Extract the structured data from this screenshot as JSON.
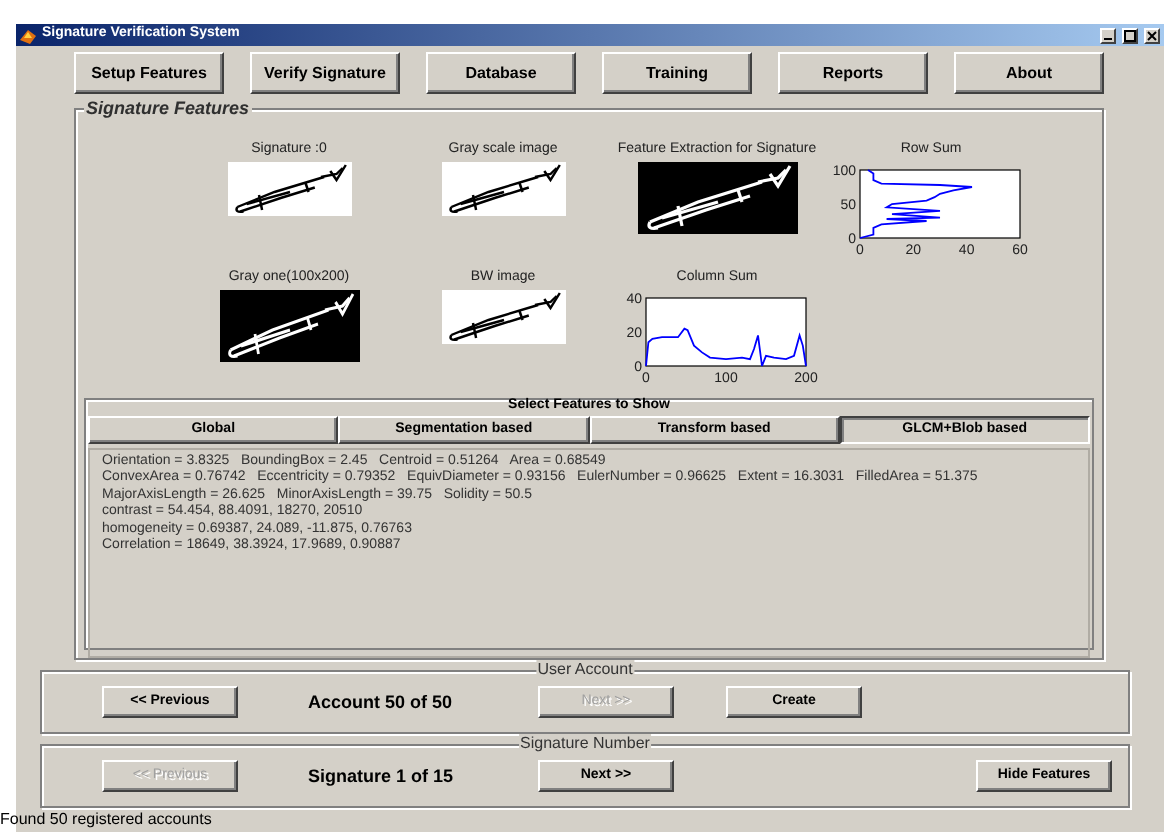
{
  "window": {
    "title": "Signature Verification System"
  },
  "menu_buttons": [
    {
      "label": "Setup Features"
    },
    {
      "label": "Verify Signature"
    },
    {
      "label": "Database"
    },
    {
      "label": "Training"
    },
    {
      "label": "Reports"
    },
    {
      "label": "About"
    }
  ],
  "signature_features": {
    "title": "Signature Features",
    "cells": [
      {
        "kind": "picture",
        "caption": "Signature :0",
        "inverted": false
      },
      {
        "kind": "picture",
        "caption": "Gray scale image",
        "inverted": false
      },
      {
        "kind": "picture",
        "caption": "Feature Extraction for Signature",
        "inverted": true
      },
      {
        "kind": "plot",
        "chart_data": {
          "type": "line",
          "title": "Row Sum",
          "x": [
            0,
            5,
            5,
            5,
            8,
            25,
            10,
            30,
            12,
            30,
            10,
            12,
            25,
            28,
            30,
            35,
            42,
            30,
            8,
            5,
            5,
            5,
            3
          ],
          "series": [
            {
              "color": "#0000ff",
              "values": [
                0,
                5,
                10,
                15,
                20,
                25,
                28,
                30,
                35,
                40,
                45,
                50,
                55,
                60,
                65,
                70,
                75,
                78,
                80,
                85,
                90,
                95,
                100
              ]
            }
          ],
          "xlim": [
            0,
            60
          ],
          "ylim": [
            0,
            100
          ],
          "xticks": [
            0,
            20,
            40,
            60
          ],
          "yticks": [
            0,
            50,
            100
          ]
        }
      },
      {
        "kind": "picture",
        "caption": "Gray one(100x200)",
        "inverted": true
      },
      {
        "kind": "picture",
        "caption": "BW image",
        "inverted": false
      },
      {
        "kind": "plot",
        "chart_data": {
          "type": "line",
          "title": "Column Sum",
          "x": [
            0,
            3,
            8,
            20,
            40,
            48,
            52,
            60,
            70,
            80,
            100,
            120,
            130,
            135,
            140,
            145,
            150,
            160,
            175,
            185,
            192,
            196,
            200
          ],
          "series": [
            {
              "color": "#0000ff",
              "values": [
                0,
                14,
                16,
                17,
                17,
                22,
                21,
                12,
                8,
                5,
                4,
                5,
                4,
                10,
                18,
                0,
                6,
                5,
                4,
                6,
                18,
                12,
                0
              ]
            }
          ],
          "xlim": [
            0,
            200
          ],
          "ylim": [
            0,
            40
          ],
          "xticks": [
            0,
            100,
            200
          ],
          "yticks": [
            0,
            20,
            40
          ]
        }
      }
    ],
    "feature_selector": {
      "title": "Select Features to Show",
      "options": [
        {
          "label": "Global",
          "selected": false
        },
        {
          "label": "Segmentation based",
          "selected": false
        },
        {
          "label": "Transform based",
          "selected": false
        },
        {
          "label": "GLCM+Blob based",
          "selected": true
        }
      ],
      "output_lines": [
        "Orientation = 3.8325   BoundingBox = 2.45   Centroid = 0.51264   Area = 0.68549",
        "ConvexArea = 0.76742   Eccentricity = 0.79352   EquivDiameter = 0.93156   EulerNumber = 0.96625   Extent = 16.3031   FilledArea = 51.375",
        "MajorAxisLength = 26.625   MinorAxisLength = 39.75   Solidity = 50.5",
        "contrast = 54.454, 88.4091, 18270, 20510",
        "homogeneity = 0.69387, 24.089, -11.875, 0.76763",
        "Correlation = 18649, 38.3924, 17.9689, 0.90887"
      ]
    }
  },
  "user_account": {
    "title": "User Account",
    "items": [
      {
        "kind": "button",
        "label": "<< Previous",
        "disabled": false
      },
      {
        "kind": "label",
        "label": "Account 50 of 50"
      },
      {
        "kind": "button",
        "label": "Next >>",
        "disabled": true
      },
      {
        "kind": "button",
        "label": "Create",
        "disabled": false
      }
    ]
  },
  "signature_number": {
    "title": "Signature Number",
    "items": [
      {
        "kind": "button",
        "label": "<< Previous",
        "disabled": true
      },
      {
        "kind": "label",
        "label": "Signature 1 of 15"
      },
      {
        "kind": "button",
        "label": "Next >>",
        "disabled": false
      },
      {
        "kind": "spacer"
      },
      {
        "kind": "button",
        "label": "Hide Features",
        "disabled": false
      }
    ]
  },
  "status_bar": "Found 50 registered accounts"
}
